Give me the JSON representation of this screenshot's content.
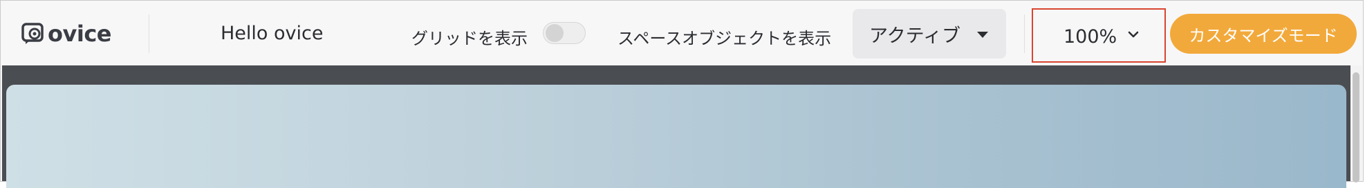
{
  "header": {
    "logo_text": "ovice",
    "space_name": "Hello ovice",
    "grid_toggle_label": "グリッドを表示",
    "grid_toggle_on": false,
    "space_object_toggle_label": "スペースオブジェクトを表示",
    "status_dropdown_value": "アクティブ",
    "zoom_value": "100%",
    "customize_button_label": "カスタマイズモード"
  },
  "colors": {
    "accent": "#f2a93b",
    "highlight_box": "#d9442f",
    "canvas_bg": "#4a4d52"
  },
  "icons": {
    "logo": "ovice-logo-icon",
    "status_caret": "caret-down-icon",
    "zoom_chevron": "chevron-down-icon"
  }
}
